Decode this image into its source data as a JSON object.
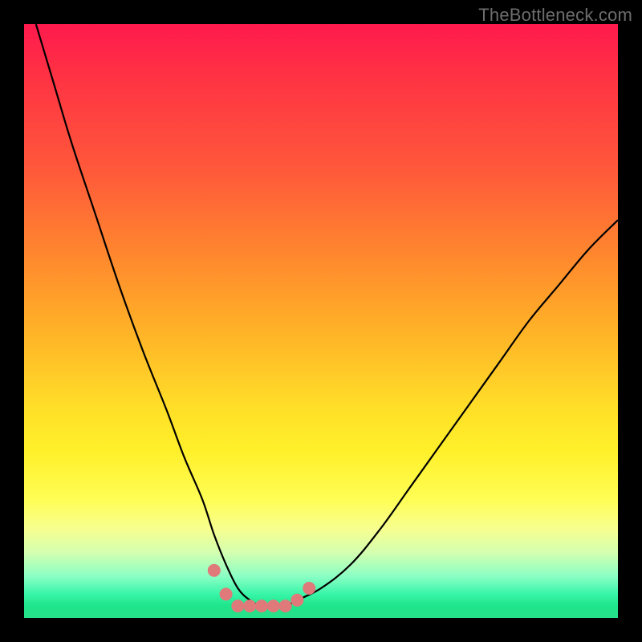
{
  "watermark": "TheBottleneck.com",
  "chart_data": {
    "type": "line",
    "title": "",
    "xlabel": "",
    "ylabel": "",
    "xlim": [
      0,
      100
    ],
    "ylim": [
      0,
      100
    ],
    "grid": false,
    "series": [
      {
        "name": "bottleneck-curve",
        "x": [
          2,
          5,
          8,
          12,
          16,
          20,
          24,
          27,
          30,
          32,
          34,
          36,
          38,
          40,
          42,
          44,
          46,
          50,
          55,
          60,
          65,
          70,
          75,
          80,
          85,
          90,
          95,
          100
        ],
        "values": [
          100,
          90,
          80,
          68,
          56,
          45,
          35,
          27,
          20,
          14,
          9,
          5,
          3,
          2,
          2,
          2,
          3,
          5,
          9,
          15,
          22,
          29,
          36,
          43,
          50,
          56,
          62,
          67
        ]
      }
    ],
    "valley_markers": {
      "name": "valley-dots",
      "x": [
        32,
        34,
        36,
        38,
        40,
        42,
        44,
        46,
        48
      ],
      "values": [
        8,
        4,
        2,
        2,
        2,
        2,
        2,
        3,
        5
      ],
      "color": "#e07a7a",
      "radius": 8
    },
    "background_gradient": {
      "top": "#ff1a4d",
      "upper_mid": "#ff8b2d",
      "mid": "#ffe028",
      "lower_mid": "#f7ff8f",
      "bottom": "#27e08a"
    }
  }
}
